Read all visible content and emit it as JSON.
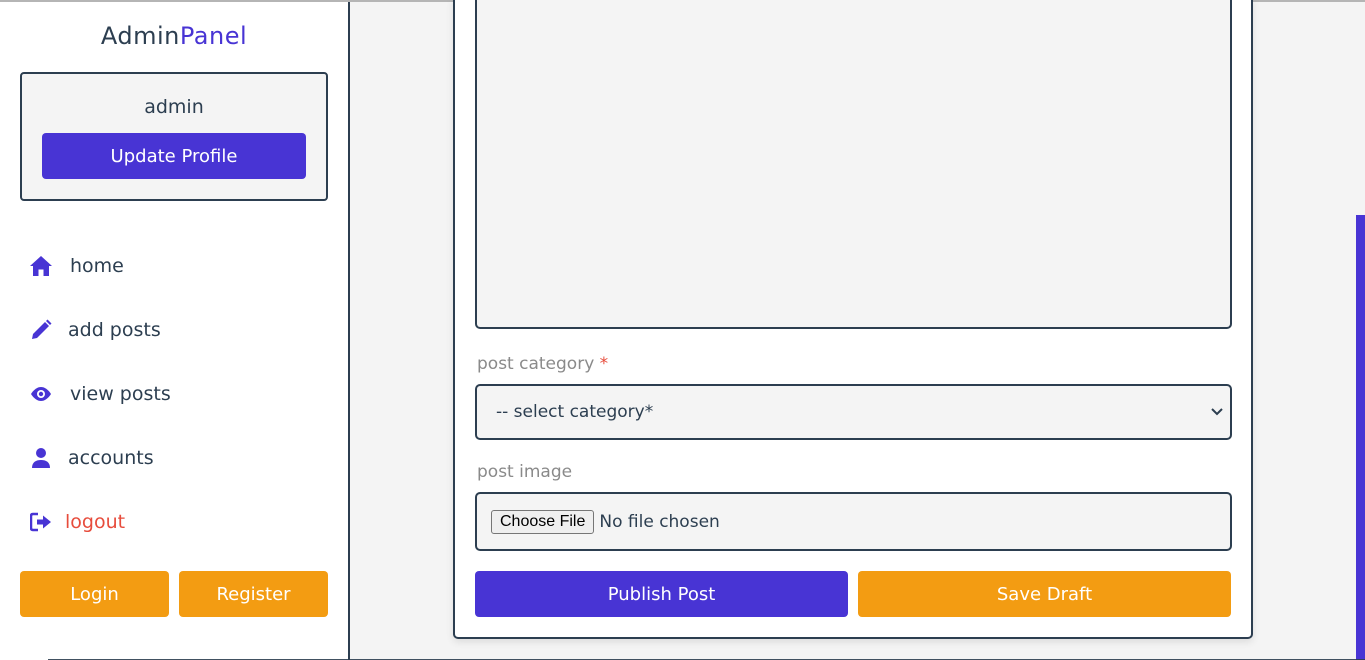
{
  "sidebar": {
    "logo": {
      "part1": "Admin",
      "part2": "Panel"
    },
    "profile": {
      "name": "admin",
      "update_label": "Update Profile"
    },
    "nav": [
      {
        "label": "home",
        "icon": "home-icon"
      },
      {
        "label": "add posts",
        "icon": "pencil-icon"
      },
      {
        "label": "view posts",
        "icon": "eye-icon"
      },
      {
        "label": "accounts",
        "icon": "user-icon"
      },
      {
        "label": "logout",
        "icon": "logout-icon"
      }
    ],
    "login_label": "Login",
    "register_label": "Register"
  },
  "form": {
    "category_label": "post category",
    "required_mark": "*",
    "category_selected": "-- select category*",
    "image_label": "post image",
    "file_button": "Choose File",
    "file_status": "No file chosen",
    "publish_label": "Publish Post",
    "draft_label": "Save Draft"
  },
  "colors": {
    "primary": "#4834d4",
    "orange": "#f39c12",
    "danger": "#e74c3c",
    "dark": "#2c3e50"
  }
}
